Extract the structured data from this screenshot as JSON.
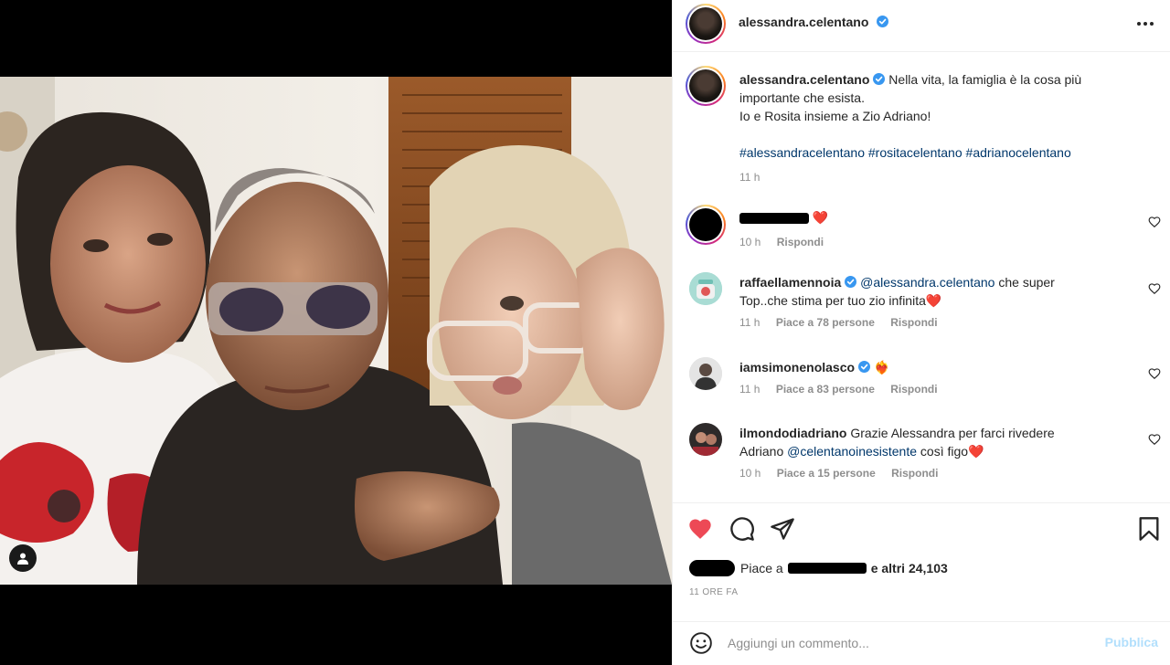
{
  "post": {
    "username": "alessandra.celentano",
    "caption_line1": "Nella vita, la famiglia è la cosa più",
    "caption_line2": "importante che esista.",
    "caption_line3": "Io e Rosita insieme a Zio Adriano!",
    "hashtag1": "#alessandracelentano",
    "hashtag2": "#rositacelentano",
    "hashtag3": "#adrianocelentano",
    "caption_time": "11 h"
  },
  "comments": [
    {
      "username": "",
      "text": "❤️",
      "time": "10 h",
      "likes": "",
      "reply": "Rispondi"
    },
    {
      "username": "raffaellamennoia",
      "mention": "@alessandra.celentano",
      "text_a": " che super",
      "text_b": "Top..che stima per tuo zio infinita❤️",
      "time": "11 h",
      "likes": "Piace a 78 persone",
      "reply": "Rispondi"
    },
    {
      "username": "iamsimonenolasco",
      "text": "❤️‍🔥",
      "time": "11 h",
      "likes": "Piace a 83 persone",
      "reply": "Rispondi"
    },
    {
      "username": "ilmondodiadriano",
      "text_a": " Grazie Alessandra per farci rivedere",
      "text_b_pre": "Adriano ",
      "mention": "@celentanoinesistente",
      "text_b_post": " così figo❤️",
      "time": "10 h",
      "likes": "Piace a 15 persone",
      "reply": "Rispondi"
    }
  ],
  "actions": {
    "likes_prefix": "Piace a",
    "likes_suffix": "e altri 24,103",
    "time_ago": "11 ore fa"
  },
  "composer": {
    "placeholder": "Aggiungi un commento...",
    "publish": "Pubblica"
  },
  "colors": {
    "like_red": "#ed4956",
    "link": "#00376b",
    "verified": "#3897f0",
    "publish_disabled": "#b2dffc"
  }
}
